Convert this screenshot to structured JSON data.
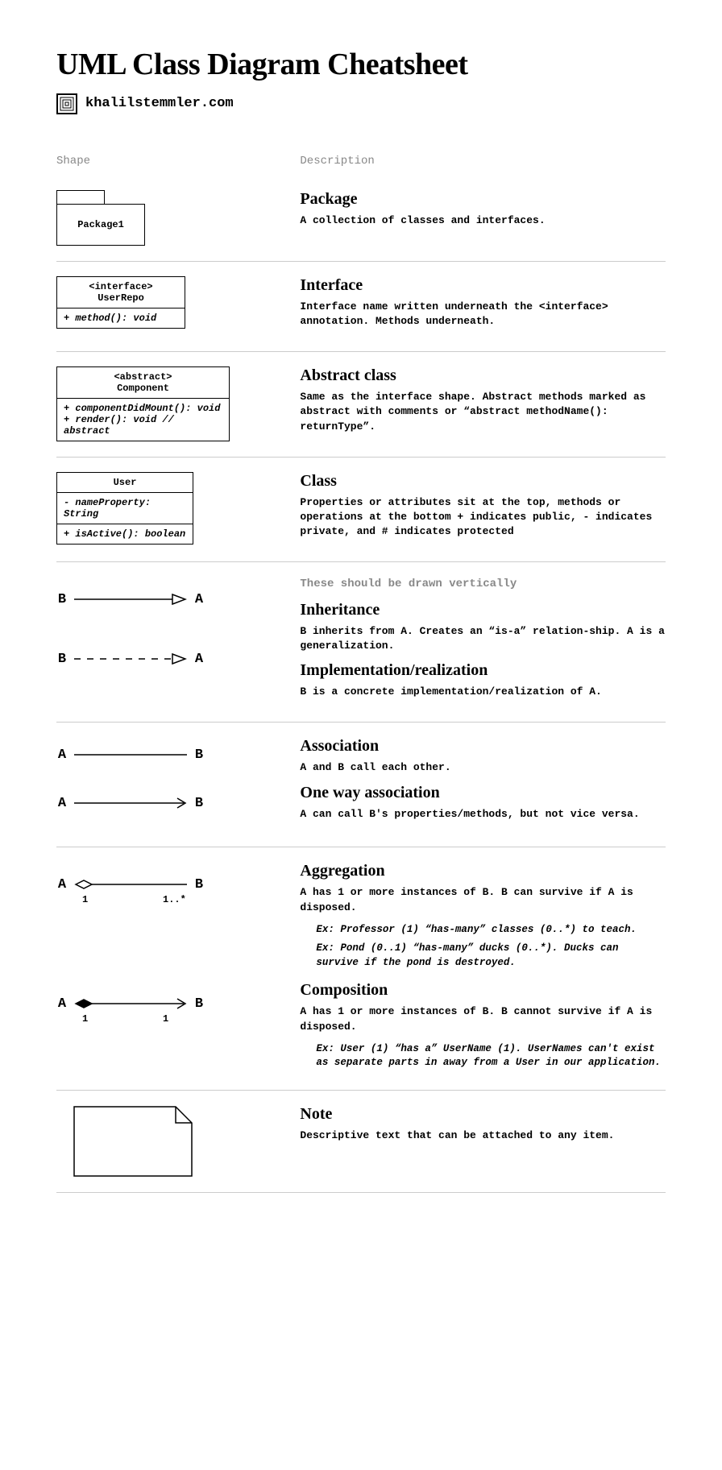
{
  "title": "UML Class Diagram Cheatsheet",
  "site": "khalilstemmler.com",
  "headers": {
    "shape": "Shape",
    "description": "Description"
  },
  "package": {
    "label": "Package1",
    "title": "Package",
    "desc": "A collection of classes and interfaces."
  },
  "interface": {
    "stereotype": "<interface>",
    "name": "UserRepo",
    "method": "+ method(): void",
    "title": "Interface",
    "desc": "Interface name written underneath the <interface> annotation. Methods underneath."
  },
  "abstract": {
    "stereotype": "<abstract>",
    "name": "Component",
    "method1": "+ componentDidMount(): void",
    "method2": "+ render(): void // abstract",
    "title": "Abstract class",
    "desc": "Same as the interface shape. Abstract methods marked as abstract with comments or “abstract methodName(): returnType”."
  },
  "class": {
    "name": "User",
    "prop": "- nameProperty: String",
    "method": "+ isActive(): boolean",
    "title": "Class",
    "desc": "Properties or attributes sit at the top, methods or operations at the bottom + indicates public, - indicates private, and # indicates protected"
  },
  "relations_note": "These should be drawn vertically",
  "inheritance": {
    "from": "B",
    "to": "A",
    "title": "Inheritance",
    "desc": "B inherits from A. Creates an “is-a” relation-ship. A is a generalization."
  },
  "implementation": {
    "from": "B",
    "to": "A",
    "title": "Implementation/realization",
    "desc": "B is a concrete implementation/realization of A."
  },
  "association": {
    "from": "A",
    "to": "B",
    "title": "Association",
    "desc": "A and B call each other."
  },
  "oneway": {
    "from": "A",
    "to": "B",
    "title": "One way association",
    "desc": "A can call B's properties/methods, but not vice versa."
  },
  "aggregation": {
    "from": "A",
    "to": "B",
    "mult_a": "1",
    "mult_b": "1..*",
    "title": "Aggregation",
    "desc": "A has 1 or more instances of B. B can survive if A is disposed.",
    "ex1": "Ex: Professor (1) “has-many” classes (0..*) to teach.",
    "ex2": "Ex: Pond (0..1) “has-many” ducks (0..*). Ducks can survive if the pond is destroyed."
  },
  "composition": {
    "from": "A",
    "to": "B",
    "mult_a": "1",
    "mult_b": "1",
    "title": "Composition",
    "desc": "A has 1 or more instances of B. B cannot survive if A is disposed.",
    "ex1": "Ex: User (1) “has a” UserName (1). UserNames can't exist as separate parts in away from a User in our application."
  },
  "note": {
    "title": "Note",
    "desc": "Descriptive text that can be attached to any item."
  }
}
